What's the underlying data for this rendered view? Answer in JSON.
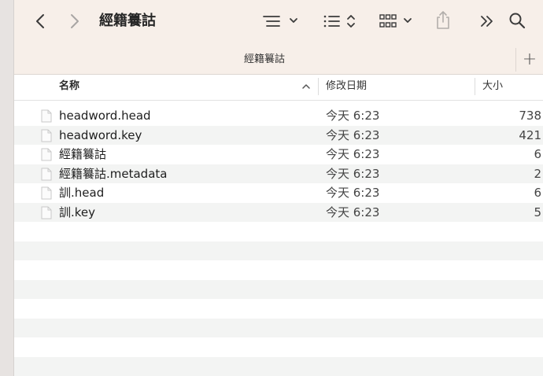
{
  "window": {
    "title": "經籍籑詁"
  },
  "tab": {
    "title": "經籍籑詁",
    "add_label": "+"
  },
  "columns": {
    "name": "名称",
    "date": "修改日期",
    "size": "大小"
  },
  "files": [
    {
      "name": "headword.head",
      "date": "今天 6:23",
      "size": "738"
    },
    {
      "name": "headword.key",
      "date": "今天 6:23",
      "size": "421"
    },
    {
      "name": "經籍籑詁",
      "date": "今天 6:23",
      "size": "6"
    },
    {
      "name": "經籍籑詁.metadata",
      "date": "今天 6:23",
      "size": "2"
    },
    {
      "name": "訓.head",
      "date": "今天 6:23",
      "size": "6"
    },
    {
      "name": "訓.key",
      "date": "今天 6:23",
      "size": "5"
    }
  ],
  "icons": {
    "back": "chevron-left-icon",
    "forward": "chevron-right-icon",
    "group": "group-by-icon",
    "list_sort": "list-sort-icon",
    "grid": "grid-view-icon",
    "share": "share-icon",
    "more": "double-chevron-icon",
    "search": "search-icon",
    "sort_direction": "chevron-up-icon",
    "file": "file-icon"
  },
  "colors": {
    "toolbar_bg": "#f7efe9",
    "row_alt": "#f3f4f3",
    "sidebar_bg": "#e7e3e1"
  }
}
